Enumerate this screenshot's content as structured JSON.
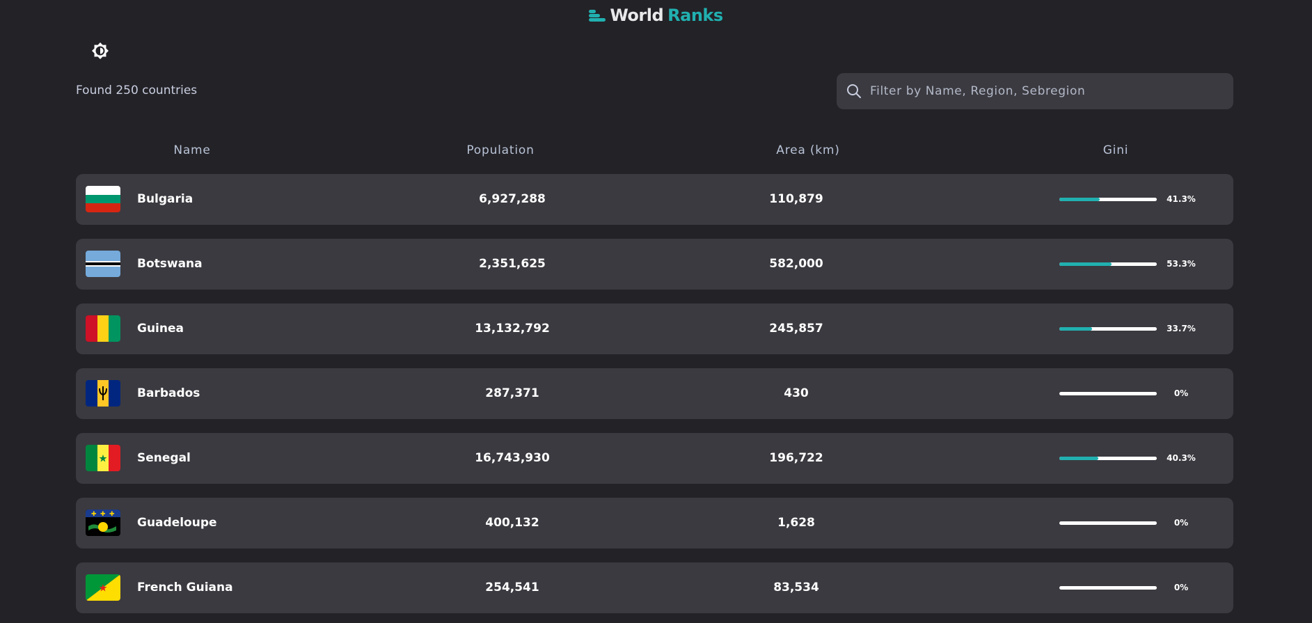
{
  "app": {
    "title_part1": "World",
    "title_part2": "Ranks",
    "accent_color": "#21b0b0",
    "logo_icon": "bars-logo-icon",
    "theme_icon": "brightness-icon"
  },
  "summary": {
    "count_text": "Found 250 countries"
  },
  "search": {
    "placeholder": "Filter by Name, Region, Sebregion",
    "value": "",
    "icon": "search-icon"
  },
  "table": {
    "headers": {
      "name": "Name",
      "population": "Population",
      "area": "Area (km)",
      "gini": "Gini"
    },
    "rows": [
      {
        "name": "Bulgaria",
        "population": "6,927,288",
        "area": "110,879",
        "gini_label": "41.3%",
        "gini": 41.3,
        "flag": "bulgaria"
      },
      {
        "name": "Botswana",
        "population": "2,351,625",
        "area": "582,000",
        "gini_label": "53.3%",
        "gini": 53.3,
        "flag": "botswana"
      },
      {
        "name": "Guinea",
        "population": "13,132,792",
        "area": "245,857",
        "gini_label": "33.7%",
        "gini": 33.7,
        "flag": "guinea"
      },
      {
        "name": "Barbados",
        "population": "287,371",
        "area": "430",
        "gini_label": "0%",
        "gini": 0,
        "flag": "barbados"
      },
      {
        "name": "Senegal",
        "population": "16,743,930",
        "area": "196,722",
        "gini_label": "40.3%",
        "gini": 40.3,
        "flag": "senegal"
      },
      {
        "name": "Guadeloupe",
        "population": "400,132",
        "area": "1,628",
        "gini_label": "0%",
        "gini": 0,
        "flag": "guadeloupe"
      },
      {
        "name": "French Guiana",
        "population": "254,541",
        "area": "83,534",
        "gini_label": "0%",
        "gini": 0,
        "flag": "french-guiana"
      }
    ]
  }
}
